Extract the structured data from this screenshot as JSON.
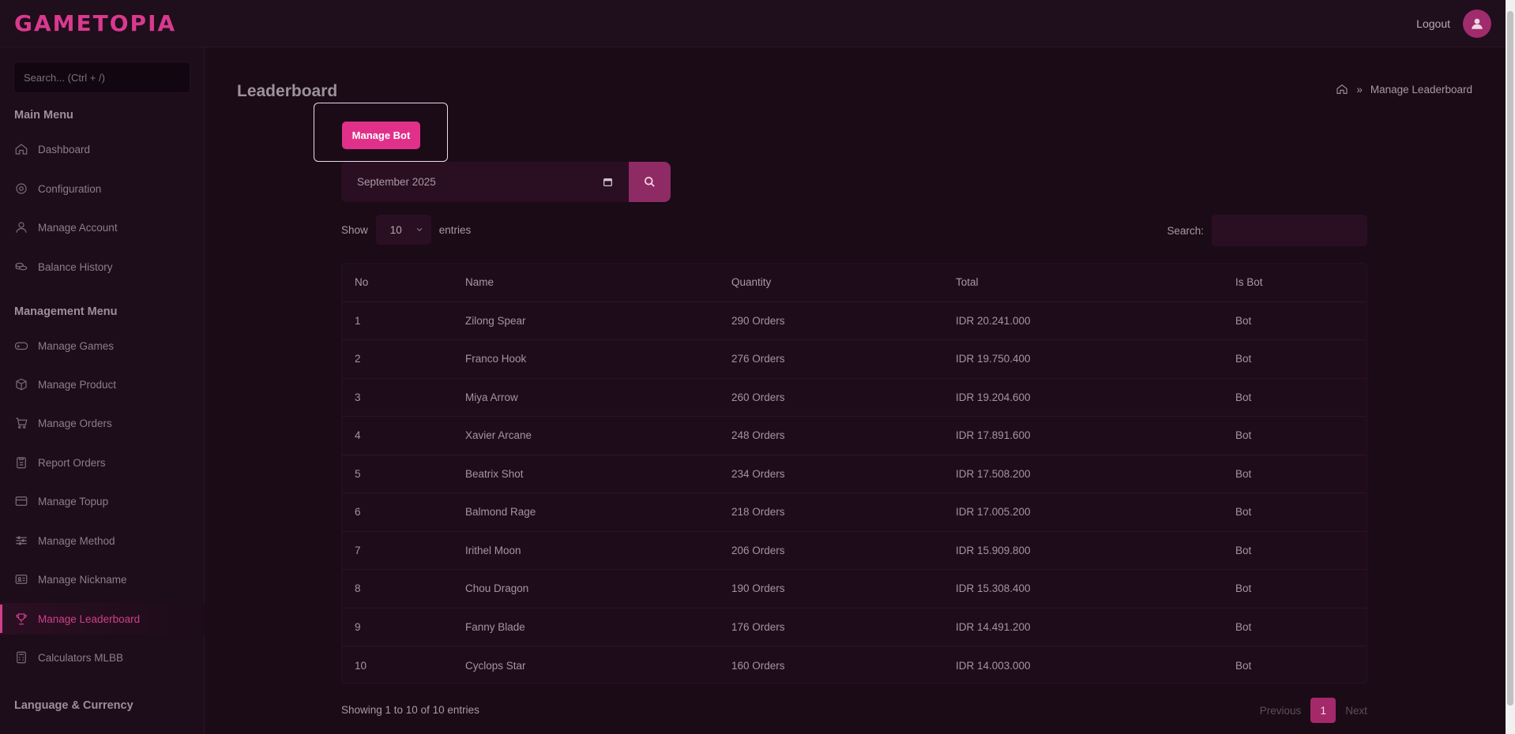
{
  "app": {
    "logo": "GAMETOPIA"
  },
  "header": {
    "logout_label": "Logout",
    "avatar_icon": "user-icon"
  },
  "sidebar": {
    "search_placeholder": "Search... (Ctrl + /)",
    "main_menu_title": "Main Menu",
    "main_items": [
      {
        "label": "Dashboard",
        "icon": "home-icon"
      },
      {
        "label": "Configuration",
        "icon": "gear-icon"
      },
      {
        "label": "Manage Account",
        "icon": "user-icon"
      },
      {
        "label": "Balance History",
        "icon": "coins-icon"
      }
    ],
    "management_menu_title": "Management Menu",
    "management_items": [
      {
        "label": "Manage Games",
        "icon": "gamepad-icon"
      },
      {
        "label": "Manage Product",
        "icon": "box-icon"
      },
      {
        "label": "Manage Orders",
        "icon": "cart-icon"
      },
      {
        "label": "Report Orders",
        "icon": "clipboard-icon"
      },
      {
        "label": "Manage Topup",
        "icon": "card-icon"
      },
      {
        "label": "Manage Method",
        "icon": "sliders-icon"
      },
      {
        "label": "Manage Nickname",
        "icon": "id-card-icon"
      },
      {
        "label": "Manage Leaderboard",
        "icon": "trophy-icon",
        "active": true
      },
      {
        "label": "Calculators MLBB",
        "icon": "calculator-icon"
      }
    ],
    "language_title": "Language & Currency"
  },
  "page": {
    "title": "Leaderboard",
    "breadcrumb_current": "Manage Leaderboard",
    "manage_bot_label": "Manage Bot",
    "month_value": "September 2025"
  },
  "table_controls": {
    "show_label": "Show",
    "entries_value": "10",
    "entries_label": "entries",
    "search_label": "Search:"
  },
  "table": {
    "columns": [
      "No",
      "Name",
      "Quantity",
      "Total",
      "Is Bot"
    ],
    "rows": [
      [
        "1",
        "Zilong Spear",
        "290 Orders",
        "IDR 20.241.000",
        "Bot"
      ],
      [
        "2",
        "Franco Hook",
        "276 Orders",
        "IDR 19.750.400",
        "Bot"
      ],
      [
        "3",
        "Miya Arrow",
        "260 Orders",
        "IDR 19.204.600",
        "Bot"
      ],
      [
        "4",
        "Xavier Arcane",
        "248 Orders",
        "IDR 17.891.600",
        "Bot"
      ],
      [
        "5",
        "Beatrix Shot",
        "234 Orders",
        "IDR 17.508.200",
        "Bot"
      ],
      [
        "6",
        "Balmond Rage",
        "218 Orders",
        "IDR 17.005.200",
        "Bot"
      ],
      [
        "7",
        "Irithel Moon",
        "206 Orders",
        "IDR 15.909.800",
        "Bot"
      ],
      [
        "8",
        "Chou Dragon",
        "190 Orders",
        "IDR 15.308.400",
        "Bot"
      ],
      [
        "9",
        "Fanny Blade",
        "176 Orders",
        "IDR 14.491.200",
        "Bot"
      ],
      [
        "10",
        "Cyclops Star",
        "160 Orders",
        "IDR 14.003.000",
        "Bot"
      ]
    ]
  },
  "footer": {
    "info": "Showing 1 to 10 of 10 entries",
    "prev_label": "Previous",
    "page_label": "1",
    "next_label": "Next"
  },
  "colors": {
    "accent": "#e0308a",
    "background": "#1a0b17"
  }
}
